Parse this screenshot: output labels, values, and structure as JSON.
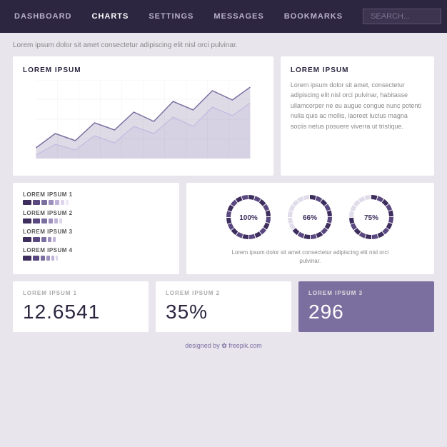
{
  "nav": {
    "items": [
      {
        "label": "DASHBOARD",
        "active": false
      },
      {
        "label": "CHARTS",
        "active": true
      },
      {
        "label": "SETTINGS",
        "active": false
      },
      {
        "label": "MESSAGES",
        "active": false
      },
      {
        "label": "BOOKMARKS",
        "active": false
      }
    ],
    "search_placeholder": "SEARCH..."
  },
  "subtitle": "Lorem ipsum dolor sit amet consectetur adipiscing elit nisl orci pulvinar.",
  "chart_card": {
    "title": "LOREM IPSUM",
    "chart_data": [
      10,
      30,
      20,
      40,
      25,
      50,
      35,
      60,
      45,
      70,
      55,
      80
    ]
  },
  "text_card": {
    "title": "LOREM IPSUM",
    "body": "Lorem ipsum dolor sit amet, consectetur adipiscing elit nisl orci pulvinar, habitasse ullamcorper ne eu augue congue nunc potenti nulla quis ac mollis, laoreet luctus magna sociis netus posuere viverra ut tristique."
  },
  "bars_card": {
    "items": [
      {
        "label": "LOREM IPSUM 1",
        "segments": [
          {
            "width": 12,
            "color": "#3d2e5e"
          },
          {
            "width": 10,
            "color": "#5a4880"
          },
          {
            "width": 8,
            "color": "#7b6fa0"
          },
          {
            "width": 7,
            "color": "#9d90bf"
          },
          {
            "width": 6,
            "color": "#beb2d8"
          },
          {
            "width": 5,
            "color": "#ddd6ee"
          },
          {
            "width": 4,
            "color": "#eee9f5"
          }
        ]
      },
      {
        "label": "LOREM IPSUM 2",
        "segments": [
          {
            "width": 12,
            "color": "#3d2e5e"
          },
          {
            "width": 10,
            "color": "#5a4880"
          },
          {
            "width": 8,
            "color": "#7b6fa0"
          },
          {
            "width": 6,
            "color": "#9d90bf"
          },
          {
            "width": 5,
            "color": "#beb2d8"
          },
          {
            "width": 4,
            "color": "#ddd6ee"
          }
        ]
      },
      {
        "label": "LOREM IPSUM 3",
        "segments": [
          {
            "width": 12,
            "color": "#3d2e5e"
          },
          {
            "width": 10,
            "color": "#5a4880"
          },
          {
            "width": 7,
            "color": "#7b6fa0"
          },
          {
            "width": 5,
            "color": "#9d90bf"
          },
          {
            "width": 4,
            "color": "#beb2d8"
          }
        ]
      },
      {
        "label": "LOREM IPSUM 4",
        "segments": [
          {
            "width": 12,
            "color": "#3d2e5e"
          },
          {
            "width": 9,
            "color": "#5a4880"
          },
          {
            "width": 6,
            "color": "#7b6fa0"
          },
          {
            "width": 5,
            "color": "#9d90bf"
          },
          {
            "width": 4,
            "color": "#beb2d8"
          },
          {
            "width": 3,
            "color": "#ddd6ee"
          }
        ]
      }
    ]
  },
  "donuts_card": {
    "items": [
      {
        "pct": 100,
        "label": "100%"
      },
      {
        "pct": 66,
        "label": "66%"
      },
      {
        "pct": 75,
        "label": "75%"
      }
    ],
    "caption": "Lorem ipsum dolor sit amet consectetur adipiscing elit nisl orci pulvinar."
  },
  "stats": [
    {
      "label": "LOREM IPSUM 1",
      "value": "12.6541",
      "accent": false
    },
    {
      "label": "LOREM IPSUM 2",
      "value": "35%",
      "accent": false
    },
    {
      "label": "LOREM IPSUM 3",
      "value": "296",
      "accent": true
    }
  ],
  "footer": {
    "text": "designed by",
    "highlight": "✿ freepik.com"
  }
}
